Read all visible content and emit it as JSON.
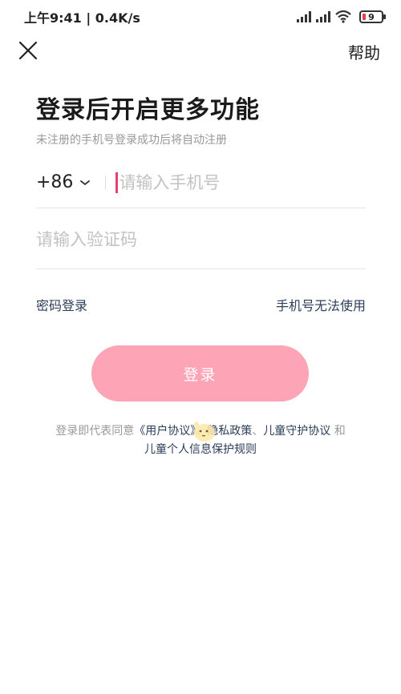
{
  "status_bar": {
    "time": "上午9:41",
    "network_speed": "0.4K/s",
    "battery_level": "9"
  },
  "nav": {
    "help_label": "帮助"
  },
  "header": {
    "title": "登录后开启更多功能",
    "subtitle": "未注册的手机号登录成功后将自动注册"
  },
  "form": {
    "country_code": "+86",
    "phone_placeholder": "请输入手机号",
    "code_placeholder": "请输入验证码",
    "password_login": "密码登录",
    "phone_unavailable": "手机号无法使用",
    "login_button": "登录"
  },
  "agreement": {
    "prefix": "登录即代表同意",
    "user_agreement": "《用户协议》",
    "sep1": "、",
    "privacy_policy": "隐私政策",
    "sep2": "、",
    "child_protection": "儿童守护协议",
    "and": " 和",
    "child_info": "儿童个人信息保护规则"
  },
  "colors": {
    "accent": "#fda0b3",
    "caret": "#e5406f",
    "link": "#2c3e5a"
  }
}
